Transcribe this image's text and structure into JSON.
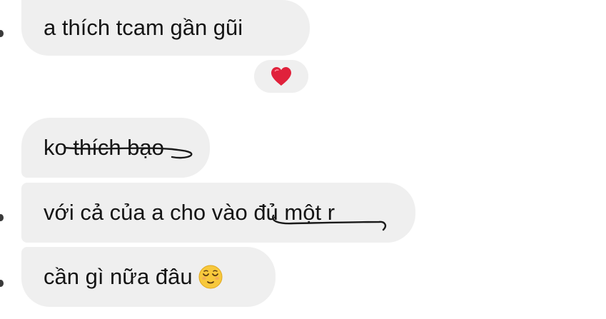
{
  "messages": [
    {
      "text": "a thích tcam gần gũi"
    },
    {
      "text": "ko thích bạo"
    },
    {
      "text": "với cả của a cho vào đủ một r"
    },
    {
      "text": "cần gì nữa đâu"
    }
  ],
  "reaction": {
    "emoji": "heart-icon",
    "color": "#e0213b"
  },
  "colors": {
    "bubble": "#efefef",
    "text": "#151515",
    "background": "#ffffff"
  }
}
